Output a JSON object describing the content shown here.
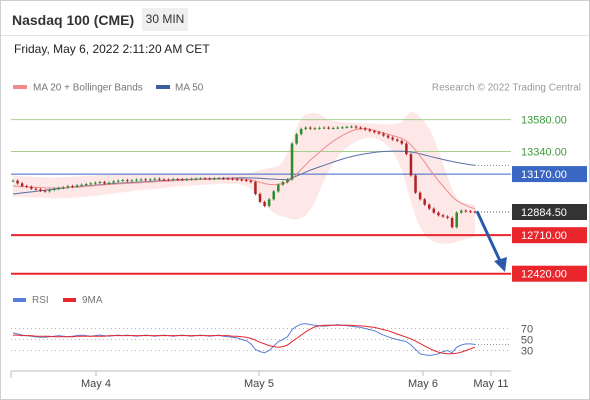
{
  "header": {
    "symbol": "Nasdaq 100 (CME)",
    "interval": "30 MIN",
    "datetime": "Friday, May 6, 2022 2:11:20 AM CET"
  },
  "colors": {
    "ma20": "#f08a8a",
    "bollinger_fill": "#fde3e3",
    "ma50": "#5b6fa8",
    "bullish": "#2e8b2e",
    "bearish": "#b22222",
    "support": "#e8262c",
    "resistance": "#a5cf8f",
    "pivot": "#3a66c4",
    "last_price_bg": "#333333",
    "arrow": "#2b5aa8",
    "rsi": "#5a7fd8",
    "rsi_ma": "#e8262c"
  },
  "legend": {
    "ma20": "MA 20 + Bollinger Bands",
    "ma50": "MA 50",
    "rsi": "RSI",
    "rsi_ma": "9MA"
  },
  "copyright": "Research © 2022 Trading Central",
  "chart_data": [
    {
      "type": "candlestick",
      "x_axis": {
        "ticks": [
          "May 4",
          "May 5",
          "May 6",
          "May 11"
        ]
      },
      "ylim": [
        12350,
        13660
      ],
      "levels": [
        {
          "value": 13580.0,
          "label": "13580.00",
          "kind": "resistance"
        },
        {
          "value": 13340.0,
          "label": "13340.00",
          "kind": "resistance"
        },
        {
          "value": 13170.0,
          "label": "13170.00",
          "kind": "pivot"
        },
        {
          "value": 12710.0,
          "label": "12710.00",
          "kind": "support"
        },
        {
          "value": 12420.0,
          "label": "12420.00",
          "kind": "support"
        }
      ],
      "last_price": {
        "value": 12884.5,
        "label": "12884.50"
      },
      "forecast_arrow": {
        "from": 12890,
        "to": 12440,
        "direction": "down"
      },
      "closes": [
        13120,
        13100,
        13080,
        13075,
        13060,
        13055,
        13045,
        13040,
        13050,
        13060,
        13065,
        13070,
        13080,
        13075,
        13085,
        13090,
        13095,
        13100,
        13105,
        13110,
        13100,
        13105,
        13115,
        13120,
        13125,
        13118,
        13122,
        13128,
        13130,
        13126,
        13130,
        13135,
        13130,
        13128,
        13126,
        13132,
        13130,
        13128,
        13130,
        13133,
        13135,
        13137,
        13136,
        13134,
        13137,
        13138,
        13136,
        13135,
        13132,
        13128,
        13125,
        13120,
        13110,
        13020,
        12960,
        12930,
        12980,
        13040,
        13090,
        13110,
        13130,
        13400,
        13470,
        13510,
        13520,
        13512,
        13515,
        13518,
        13520,
        13515,
        13517,
        13520,
        13522,
        13525,
        13528,
        13520,
        13515,
        13505,
        13495,
        13485,
        13475,
        13460,
        13445,
        13430,
        13420,
        13400,
        13320,
        13160,
        13030,
        12980,
        12940,
        12910,
        12880,
        12860,
        12850,
        12840,
        12770,
        12880,
        12895,
        12890,
        12887,
        12884.5
      ],
      "ma20": [
        13080,
        13078,
        13076,
        13074,
        13072,
        13070,
        13068,
        13066,
        13065,
        13065,
        13066,
        13067,
        13068,
        13070,
        13072,
        13074,
        13077,
        13080,
        13083,
        13086,
        13089,
        13092,
        13094,
        13096,
        13098,
        13100,
        13102,
        13104,
        13106,
        13108,
        13110,
        13112,
        13114,
        13116,
        13118,
        13120,
        13122,
        13124,
        13126,
        13127,
        13128,
        13129,
        13130,
        13131,
        13132,
        13133,
        13133,
        13134,
        13134,
        13134,
        13133,
        13130,
        13126,
        13118,
        13108,
        13098,
        13092,
        13090,
        13092,
        13098,
        13108,
        13135,
        13170,
        13205,
        13240,
        13275,
        13305,
        13335,
        13365,
        13392,
        13418,
        13440,
        13460,
        13478,
        13494,
        13506,
        13512,
        13512,
        13508,
        13500,
        13490,
        13480,
        13470,
        13460,
        13450,
        13438,
        13420,
        13390,
        13350,
        13305,
        13260,
        13210,
        13165,
        13120,
        13080,
        13040,
        13000,
        12970,
        12950,
        12935,
        12920,
        12910
      ],
      "ma50": [
        13020,
        13024,
        13028,
        13032,
        13036,
        13040,
        13044,
        13048,
        13052,
        13056,
        13060,
        13064,
        13068,
        13072,
        13075,
        13078,
        13081,
        13084,
        13087,
        13090,
        13093,
        13096,
        13099,
        13101,
        13103,
        13105,
        13107,
        13109,
        13111,
        13113,
        13115,
        13117,
        13119,
        13121,
        13123,
        13125,
        13127,
        13129,
        13130,
        13131,
        13132,
        13133,
        13134,
        13135,
        13136,
        13137,
        13138,
        13139,
        13140,
        13141,
        13141,
        13141,
        13141,
        13140,
        13138,
        13136,
        13134,
        13132,
        13130,
        13129,
        13128,
        13140,
        13155,
        13170,
        13185,
        13200,
        13212,
        13224,
        13236,
        13248,
        13260,
        13272,
        13283,
        13293,
        13302,
        13310,
        13317,
        13323,
        13328,
        13333,
        13337,
        13340,
        13342,
        13343,
        13343,
        13342,
        13340,
        13336,
        13330,
        13322,
        13314,
        13305,
        13296,
        13288,
        13280,
        13272,
        13265,
        13258,
        13252,
        13246,
        13241,
        13236
      ],
      "bb_upper": [
        13160,
        13158,
        13155,
        13152,
        13150,
        13148,
        13146,
        13145,
        13144,
        13144,
        13145,
        13146,
        13148,
        13150,
        13152,
        13154,
        13156,
        13158,
        13160,
        13162,
        13163,
        13164,
        13165,
        13166,
        13167,
        13168,
        13169,
        13170,
        13170,
        13170,
        13170,
        13170,
        13170,
        13170,
        13170,
        13170,
        13170,
        13170,
        13170,
        13170,
        13170,
        13170,
        13170,
        13170,
        13170,
        13170,
        13170,
        13170,
        13170,
        13170,
        13170,
        13175,
        13180,
        13190,
        13200,
        13210,
        13215,
        13220,
        13230,
        13260,
        13330,
        13420,
        13520,
        13590,
        13620,
        13630,
        13630,
        13620,
        13600,
        13580,
        13570,
        13565,
        13560,
        13558,
        13556,
        13555,
        13554,
        13552,
        13550,
        13548,
        13546,
        13545,
        13545,
        13545,
        13550,
        13560,
        13610,
        13640,
        13630,
        13600,
        13560,
        13510,
        13440,
        13350,
        13250,
        13150,
        13060,
        12990,
        12960,
        12950,
        12945,
        12940
      ],
      "bb_lower": [
        13000,
        12998,
        12996,
        12995,
        12994,
        12993,
        12992,
        12990,
        12988,
        12986,
        12986,
        12988,
        12990,
        12992,
        12994,
        12996,
        12999,
        13002,
        13006,
        13010,
        13015,
        13020,
        13024,
        13028,
        13032,
        13036,
        13040,
        13044,
        13048,
        13052,
        13055,
        13058,
        13062,
        13066,
        13070,
        13074,
        13078,
        13080,
        13082,
        13084,
        13086,
        13088,
        13090,
        13092,
        13094,
        13096,
        13096,
        13096,
        13096,
        13094,
        13090,
        13080,
        13060,
        13020,
        12980,
        12940,
        12910,
        12880,
        12860,
        12850,
        12840,
        12830,
        12830,
        12840,
        12860,
        12900,
        12960,
        13040,
        13120,
        13190,
        13250,
        13300,
        13340,
        13370,
        13395,
        13415,
        13430,
        13440,
        13445,
        13440,
        13430,
        13410,
        13380,
        13340,
        13280,
        13200,
        13080,
        12960,
        12850,
        12770,
        12710,
        12680,
        12660,
        12650,
        12645,
        12645,
        12650,
        12660,
        12670,
        12680,
        12690,
        12700
      ]
    },
    {
      "type": "line",
      "name": "RSI",
      "ylim": [
        0,
        100
      ],
      "y_ticks": [
        70,
        50,
        30
      ],
      "rsi": [
        62,
        60,
        58,
        57,
        56,
        55,
        54,
        54,
        55,
        56,
        57,
        56,
        55,
        56,
        57,
        58,
        57,
        56,
        57,
        58,
        57,
        56,
        57,
        58,
        57,
        58,
        57,
        56,
        57,
        58,
        57,
        56,
        57,
        58,
        57,
        56,
        57,
        58,
        57,
        56,
        57,
        58,
        57,
        56,
        57,
        58,
        56,
        55,
        54,
        53,
        50,
        48,
        42,
        32,
        28,
        26,
        30,
        38,
        46,
        50,
        55,
        68,
        74,
        78,
        79,
        77,
        76,
        75,
        74,
        75,
        76,
        77,
        76,
        75,
        74,
        73,
        72,
        70,
        68,
        66,
        62,
        58,
        55,
        52,
        50,
        48,
        46,
        40,
        32,
        24,
        22,
        21,
        22,
        24,
        28,
        30,
        26,
        36,
        40,
        42,
        42,
        41
      ],
      "ma9": [
        58,
        58,
        57,
        57,
        57,
        56,
        56,
        56,
        56,
        55,
        55,
        55,
        55,
        55,
        56,
        56,
        56,
        56,
        56,
        56,
        56,
        57,
        57,
        57,
        57,
        57,
        57,
        57,
        57,
        57,
        57,
        57,
        57,
        57,
        57,
        57,
        57,
        57,
        57,
        57,
        57,
        57,
        57,
        57,
        57,
        57,
        57,
        57,
        56,
        56,
        55,
        54,
        52,
        49,
        45,
        42,
        39,
        37,
        36,
        37,
        40,
        46,
        52,
        58,
        64,
        69,
        73,
        75,
        76,
        76,
        76,
        76,
        76,
        76,
        76,
        75,
        75,
        74,
        73,
        72,
        70,
        68,
        66,
        63,
        60,
        57,
        54,
        51,
        47,
        43,
        38,
        34,
        30,
        27,
        25,
        24,
        24,
        25,
        27,
        30,
        33,
        36
      ]
    }
  ]
}
